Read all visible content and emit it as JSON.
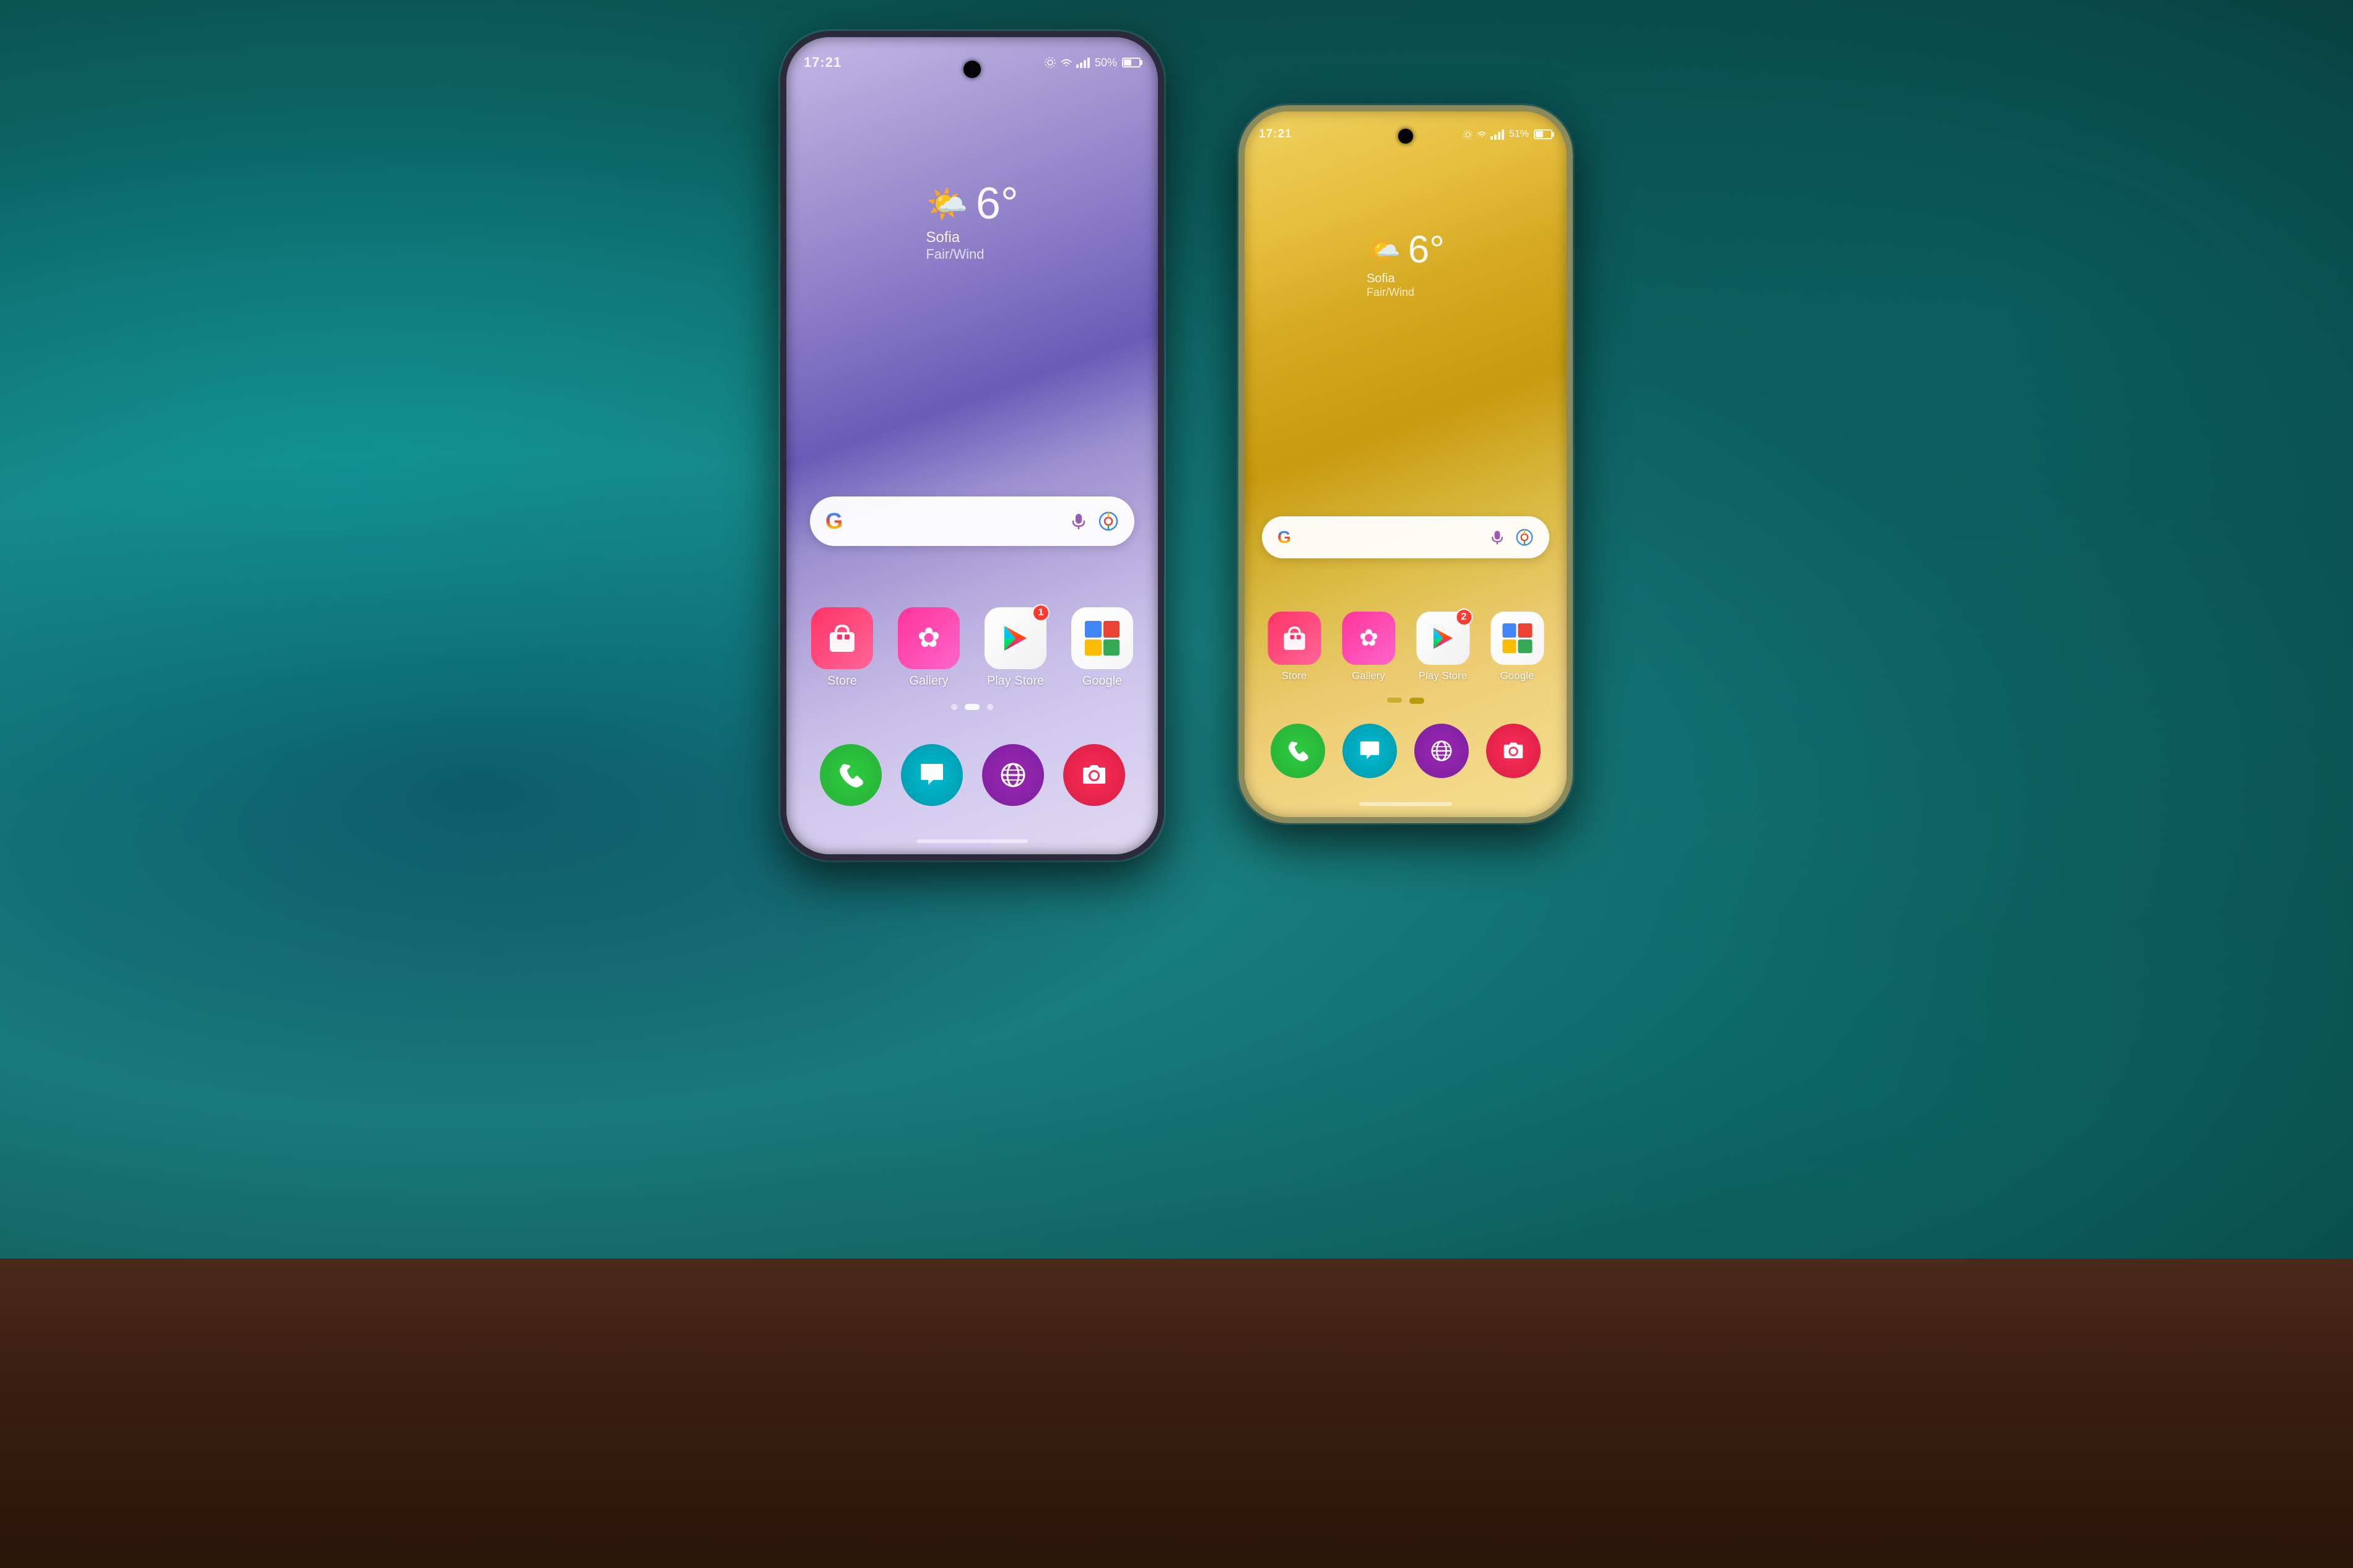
{
  "background": {
    "color": "#1a6b6e"
  },
  "phone_left": {
    "color": "purple/violet",
    "status_bar": {
      "time": "17:21",
      "battery": "50%",
      "icons": [
        "settings",
        "wifi",
        "signal",
        "battery"
      ]
    },
    "weather": {
      "icon": "🌤️",
      "temperature": "6°",
      "city": "Sofia",
      "condition": "Fair/Wind"
    },
    "search_bar": {
      "google_letter": "G"
    },
    "apps": [
      {
        "name": "Store",
        "icon": "store",
        "badge": null
      },
      {
        "name": "Gallery",
        "icon": "gallery",
        "badge": null
      },
      {
        "name": "Play Store",
        "icon": "playstore",
        "badge": "1"
      },
      {
        "name": "Google",
        "icon": "google",
        "badge": null
      }
    ],
    "dock": [
      {
        "name": "Phone",
        "icon": "phone"
      },
      {
        "name": "Messages",
        "icon": "messages"
      },
      {
        "name": "Internet",
        "icon": "internet"
      },
      {
        "name": "Camera",
        "icon": "camera"
      }
    ],
    "page_dots": [
      {
        "active": false
      },
      {
        "active": true
      },
      {
        "active": false
      }
    ]
  },
  "phone_right": {
    "color": "yellow/gold",
    "status_bar": {
      "time": "17:21",
      "battery": "51%",
      "icons": [
        "settings",
        "wifi",
        "signal",
        "battery"
      ]
    },
    "weather": {
      "icon": "🌤️",
      "temperature": "6°",
      "city": "Sofia",
      "condition": "Fair/Wind"
    },
    "search_bar": {
      "google_letter": "G"
    },
    "apps": [
      {
        "name": "Store",
        "icon": "store",
        "badge": null
      },
      {
        "name": "Gallery",
        "icon": "gallery",
        "badge": null
      },
      {
        "name": "Play Store",
        "icon": "playstore",
        "badge": "2"
      },
      {
        "name": "Google",
        "icon": "google",
        "badge": null
      }
    ],
    "dock": [
      {
        "name": "Phone",
        "icon": "phone"
      },
      {
        "name": "Messages",
        "icon": "messages"
      },
      {
        "name": "Internet",
        "icon": "internet"
      },
      {
        "name": "Camera",
        "icon": "camera"
      }
    ],
    "page_dots": [
      {
        "active": false
      },
      {
        "active": true
      }
    ]
  }
}
